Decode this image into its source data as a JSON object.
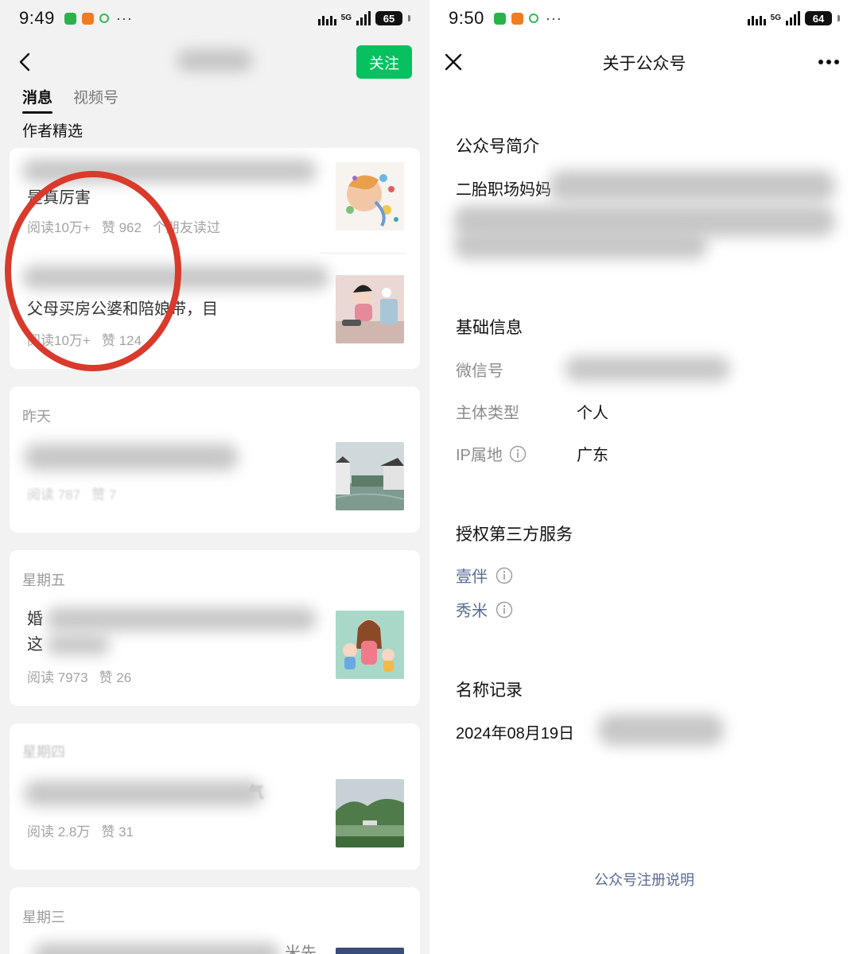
{
  "left": {
    "status": {
      "time": "9:49",
      "network": "5G",
      "battery": "65"
    },
    "header": {
      "follow_label": "关注"
    },
    "tabs": [
      {
        "label": "消息",
        "active": true
      },
      {
        "label": "视频号",
        "active": false
      }
    ],
    "section_title": "作者精选",
    "featured": [
      {
        "title_visible": "是真厉害",
        "reads": "阅读10万+",
        "likes": "赞 962",
        "friends": "个朋友读过"
      },
      {
        "title_visible": "父母买房公婆和陪娘带，目",
        "reads": "阅读10万+",
        "likes": "赞 124"
      }
    ],
    "groups": [
      {
        "date": "昨天",
        "title_visible": "",
        "reads": "阅读 787",
        "likes": "赞 7"
      },
      {
        "date": "星期五",
        "title_visible": "婚",
        "title_line2": "这",
        "reads": "阅读 7973",
        "likes": "赞 26"
      },
      {
        "date": "星期四",
        "title_visible": "气",
        "reads": "阅读 2.8万",
        "likes": "赞 31"
      },
      {
        "date": "星期三",
        "title_visible": "米先",
        "reads": "",
        "likes": ""
      }
    ]
  },
  "right": {
    "status": {
      "time": "9:50",
      "network": "5G",
      "battery": "64"
    },
    "header": {
      "title": "关于公众号"
    },
    "intro": {
      "heading": "公众号简介",
      "text_visible": "二胎职场妈妈"
    },
    "basic": {
      "heading": "基础信息",
      "wechat_id_label": "微信号",
      "entity_type_label": "主体类型",
      "entity_type_value": "个人",
      "ip_label": "IP属地",
      "ip_value": "广东"
    },
    "third_party": {
      "heading": "授权第三方服务",
      "services": [
        "壹伴",
        "秀米"
      ]
    },
    "name_history": {
      "heading": "名称记录",
      "date": "2024年08月19日"
    },
    "footer_link": "公众号注册说明"
  },
  "colors": {
    "follow_green": "#07c160",
    "link_blue": "#576b95",
    "annotation_red": "#d93a2b"
  },
  "icons": [
    "back-icon",
    "close-icon",
    "more-icon",
    "info-icon",
    "wechat-icon",
    "taobao-icon",
    "recycle-icon",
    "router-icon",
    "signal-icon",
    "battery-icon"
  ]
}
